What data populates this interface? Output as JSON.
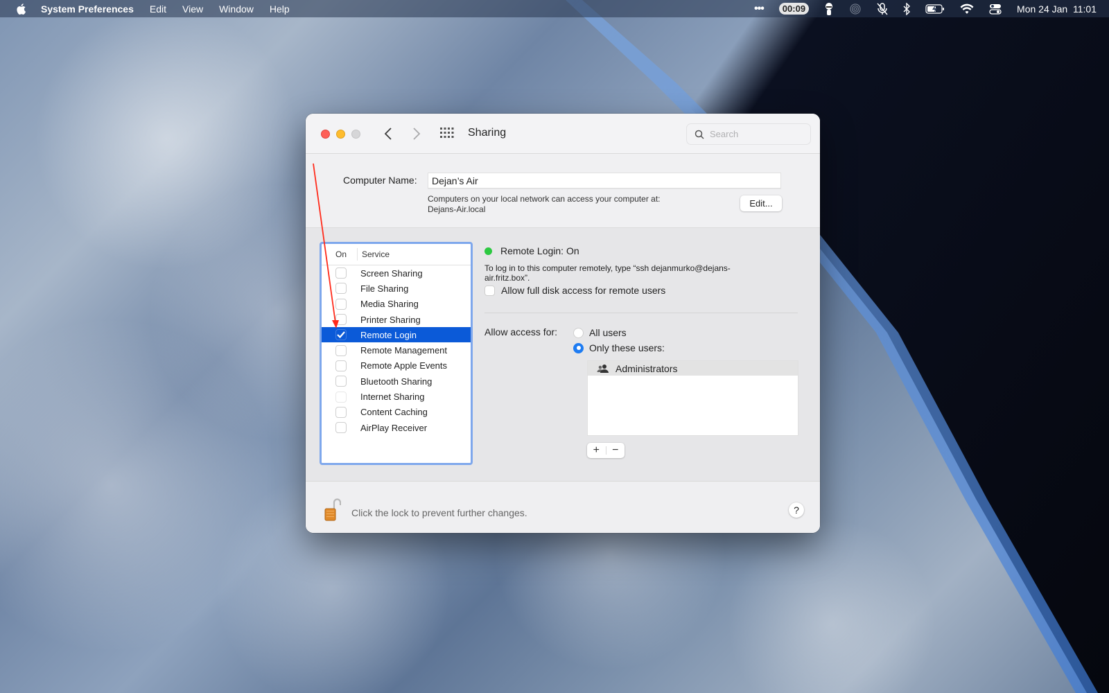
{
  "menubar": {
    "app_name": "System Preferences",
    "items": [
      "Edit",
      "View",
      "Window",
      "Help"
    ],
    "tray": {
      "more_icon": "ellipsis-icon",
      "timer": "00:09",
      "date": "Mon 24 Jan",
      "time": "11:01"
    }
  },
  "window": {
    "title": "Sharing",
    "search": {
      "placeholder": "Search",
      "value": ""
    },
    "computer_name": {
      "label": "Computer Name:",
      "value": "Dejan’s Air",
      "note_line1": "Computers on your local network can access your computer at:",
      "note_line2": "Dejans-Air.local",
      "edit_button": "Edit..."
    },
    "service_list": {
      "header_on": "On",
      "header_service": "Service",
      "items": [
        {
          "label": "Screen Sharing",
          "checked": false,
          "enabled": true,
          "selected": false
        },
        {
          "label": "File Sharing",
          "checked": false,
          "enabled": true,
          "selected": false
        },
        {
          "label": "Media Sharing",
          "checked": false,
          "enabled": true,
          "selected": false
        },
        {
          "label": "Printer Sharing",
          "checked": false,
          "enabled": true,
          "selected": false
        },
        {
          "label": "Remote Login",
          "checked": true,
          "enabled": true,
          "selected": true
        },
        {
          "label": "Remote Management",
          "checked": false,
          "enabled": true,
          "selected": false
        },
        {
          "label": "Remote Apple Events",
          "checked": false,
          "enabled": true,
          "selected": false
        },
        {
          "label": "Bluetooth Sharing",
          "checked": false,
          "enabled": true,
          "selected": false
        },
        {
          "label": "Internet Sharing",
          "checked": false,
          "enabled": false,
          "selected": false
        },
        {
          "label": "Content Caching",
          "checked": false,
          "enabled": true,
          "selected": false
        },
        {
          "label": "AirPlay Receiver",
          "checked": false,
          "enabled": true,
          "selected": false
        }
      ]
    },
    "detail": {
      "status": "Remote Login: On",
      "status_color": "#2cc941",
      "description": "To log in to this computer remotely, type “ssh dejanmurko@dejans-air.fritz.box”.",
      "full_disk_access_label": "Allow full disk access for remote users",
      "full_disk_access_checked": false,
      "access_label": "Allow access for:",
      "access_options": [
        {
          "label": "All users",
          "selected": false
        },
        {
          "label": "Only these users:",
          "selected": true
        }
      ],
      "users": [
        "Administrators"
      ],
      "add_button": "+",
      "remove_button": "−"
    },
    "footer": {
      "lock_text": "Click the lock to prevent further changes.",
      "help_button": "?"
    }
  },
  "colors": {
    "selection": "#0b5ad8",
    "list_focus_ring": "#7ea7ec",
    "radio_accent": "#1e7cf2",
    "annotation_arrow": "#ff2a1a"
  }
}
